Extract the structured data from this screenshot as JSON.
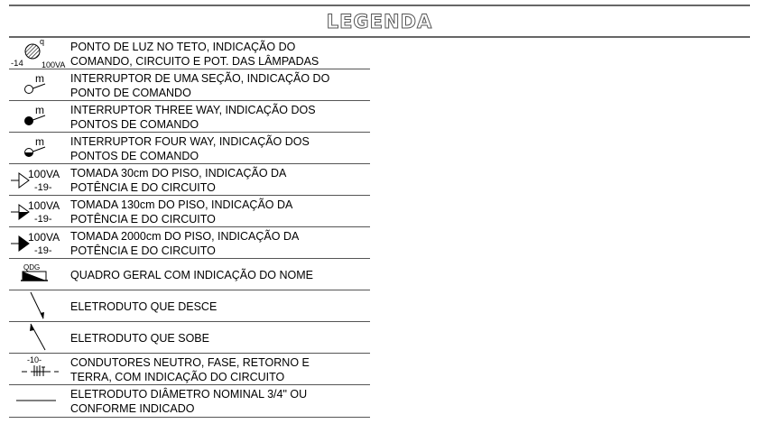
{
  "title": "LEGENDA",
  "rows": [
    {
      "symbol": "ceiling-light-icon",
      "sym_labels": {
        "q": "q",
        "circuit": "-14",
        "power": "100VA"
      },
      "text": "PONTO DE LUZ NO TETO, INDICAÇÃO DO\nCOMANDO, CIRCUITO E POT. DAS LÂMPADAS"
    },
    {
      "symbol": "single-switch-icon",
      "sym_labels": {
        "cmd": "m"
      },
      "text": "INTERRUPTOR DE UMA SEÇÃO, INDICAÇÃO DO\nPONTO DE COMANDO"
    },
    {
      "symbol": "three-way-switch-icon",
      "sym_labels": {
        "cmd": "m"
      },
      "text": "INTERRUPTOR THREE  WAY, INDICAÇÃO DOS\nPONTOS DE COMANDO"
    },
    {
      "symbol": "four-way-switch-icon",
      "sym_labels": {
        "cmd": "m"
      },
      "text": "INTERRUPTOR FOUR WAY, INDICAÇÃO DOS\nPONTOS DE COMANDO"
    },
    {
      "symbol": "outlet-low-icon",
      "sym_labels": {
        "power": "100VA",
        "circuit": "-19-"
      },
      "text": "TOMADA 30cm DO PISO, INDICAÇÃO DA\nPOTÊNCIA E DO CIRCUITO"
    },
    {
      "symbol": "outlet-mid-icon",
      "sym_labels": {
        "power": "100VA",
        "circuit": "-19-"
      },
      "text": "TOMADA 130cm DO PISO, INDICAÇÃO DA\nPOTÊNCIA E DO CIRCUITO"
    },
    {
      "symbol": "outlet-high-icon",
      "sym_labels": {
        "power": "100VA",
        "circuit": "-19-"
      },
      "text": "TOMADA 2000cm DO PISO, INDICAÇÃO DA\nPOTÊNCIA E DO CIRCUITO"
    },
    {
      "symbol": "main-panel-icon",
      "sym_labels": {
        "name": "QDG"
      },
      "text": "QUADRO GERAL COM INDICAÇÃO DO NOME"
    },
    {
      "symbol": "conduit-down-icon",
      "sym_labels": {},
      "text": "ELETRODUTO QUE DESCE"
    },
    {
      "symbol": "conduit-up-icon",
      "sym_labels": {},
      "text": "ELETRODUTO QUE SOBE"
    },
    {
      "symbol": "conductors-icon",
      "sym_labels": {
        "circuit": "-10-"
      },
      "text": "CONDUTORES NEUTRO, FASE, RETORNO E\nTERRA, COM INDICAÇÃO DO CIRCUITO"
    },
    {
      "symbol": "conduit-line-icon",
      "sym_labels": {},
      "text": "ELETRODUTO DIÂMETRO NOMINAL 3/4\" OU\nCONFORME INDICADO"
    }
  ]
}
